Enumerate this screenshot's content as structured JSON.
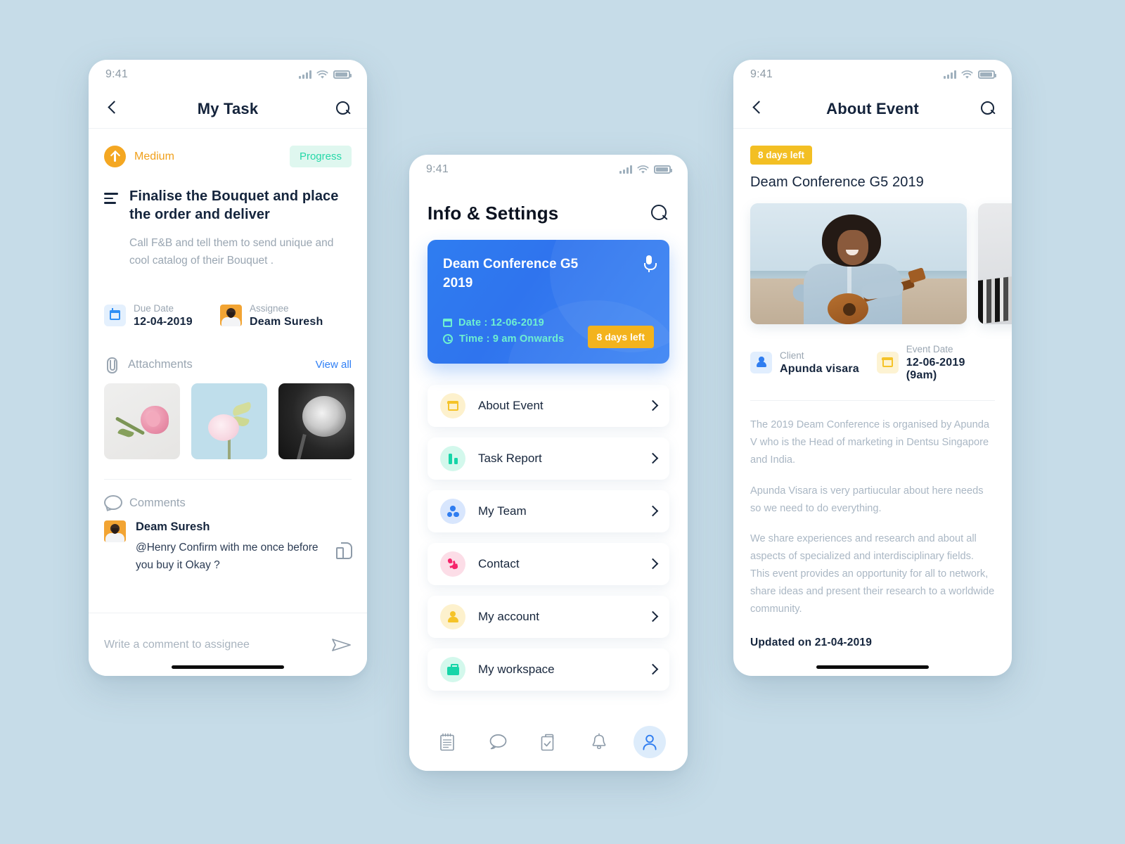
{
  "background_color": "#c6dce8",
  "screens": [
    {
      "name": "my-task",
      "status_bar": {
        "time": "9:41"
      },
      "nav": {
        "title": "My Task",
        "back_icon": "chevron-left-icon",
        "search_icon": "search-icon"
      },
      "priority": {
        "label": "Medium",
        "icon": "arrow-up-icon",
        "color": "#f0a01c"
      },
      "status": {
        "label": "Progress",
        "color": "#25d8a8",
        "bg": "#dff7ef"
      },
      "task": {
        "title": "Finalise the Bouquet and place the order and deliver",
        "description": "Call F&B and tell them to send unique and cool catalog of their Bouquet ."
      },
      "meta": [
        {
          "icon": "calendar-icon",
          "label": "Due Date",
          "value": "12-04-2019"
        },
        {
          "icon": "avatar",
          "label": "Assignee",
          "value": "Deam Suresh"
        }
      ],
      "attachments": {
        "icon": "paperclip-icon",
        "title": "Attachments",
        "action": "View all",
        "items": [
          "pink-rose-photo",
          "pink-hydrangea-photo",
          "bw-chrysanthemum-photo"
        ]
      },
      "comments": {
        "icon": "comment-bubble-icon",
        "title": "Comments",
        "items": [
          {
            "author": "Deam Suresh",
            "text": "@Henry Confirm with me once before you buy it Okay ?",
            "like_icon": "thumbs-up-icon"
          }
        ]
      },
      "comment_input": {
        "placeholder": "Write a comment to assignee",
        "value": "",
        "send_icon": "send-icon"
      }
    },
    {
      "name": "info-settings",
      "status_bar": {
        "time": "9:41"
      },
      "header": {
        "title": "Info & Settings",
        "search_icon": "search-icon"
      },
      "event_card": {
        "title": "Deam Conference G5 2019",
        "mic_icon": "microphone-icon",
        "date_line": "Date : 12-06-2019",
        "time_line": "Time : 9 am Onwards",
        "date_icon": "calendar-icon",
        "time_icon": "clock-icon",
        "days_badge": "8 days left",
        "accent_color": "#6ef0d0",
        "bg_color": "#2f7df0",
        "badge_color": "#f3b31d"
      },
      "menu": [
        {
          "label": "About Event",
          "icon": "calendar-icon",
          "icon_class": "ic-cal"
        },
        {
          "label": "Task Report",
          "icon": "bar-chart-icon",
          "icon_class": "ic-bar"
        },
        {
          "label": "My Team",
          "icon": "team-icon",
          "icon_class": "ic-team"
        },
        {
          "label": "Contact",
          "icon": "phone-icon",
          "icon_class": "ic-phone"
        },
        {
          "label": "My account",
          "icon": "person-icon",
          "icon_class": "ic-user"
        },
        {
          "label": "My workspace",
          "icon": "briefcase-icon",
          "icon_class": "ic-bag"
        }
      ],
      "tabs": [
        {
          "icon": "notepad-icon",
          "active": false
        },
        {
          "icon": "chat-bubble-icon",
          "active": false
        },
        {
          "icon": "clipboard-check-icon",
          "active": false
        },
        {
          "icon": "bell-icon",
          "active": false
        },
        {
          "icon": "person-icon",
          "active": true
        }
      ]
    },
    {
      "name": "about-event",
      "status_bar": {
        "time": "9:41"
      },
      "nav": {
        "title": "About Event",
        "back_icon": "chevron-left-icon",
        "search_icon": "search-icon"
      },
      "days_badge": "8 days left",
      "title": "Deam Conference G5 2019",
      "gallery": [
        "woman-with-ukulele-on-beach-photo",
        "architecture-building-photo"
      ],
      "meta": [
        {
          "icon": "person-icon",
          "label": "Client",
          "value": "Apunda visara"
        },
        {
          "icon": "calendar-icon",
          "label": "Event Date",
          "value": "12-06-2019 (9am)"
        }
      ],
      "paragraphs": [
        "The 2019 Deam Conference is organised by Apunda V who is the Head of marketing in Dentsu Singapore and India.",
        "Apunda Visara is very partiucular about here needs so we need to do everything.",
        "We share experiences and research and about all aspects of specialized and interdisciplinary fields. This event provides an opportunity for all to network, share ideas and present their research  to a worldwide community."
      ],
      "updated": "Updated on 21-04-2019"
    }
  ]
}
